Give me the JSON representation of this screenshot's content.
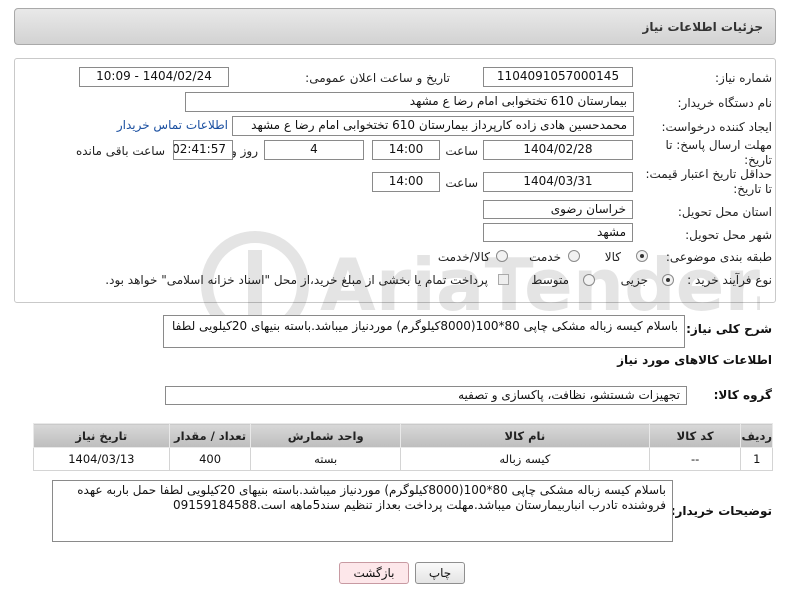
{
  "header": {
    "title": "جزئیات اطلاعات نیاز"
  },
  "form": {
    "need_number_label": "شماره نیاز:",
    "need_number": "1104091057000145",
    "announce_label": "تاریخ و ساعت اعلان عمومی:",
    "announce_value": "1404/02/24 - 10:09",
    "buyer_org_label": "نام دستگاه خریدار:",
    "buyer_org": "بیمارستان 610 تختخوابی امام رضا ع  مشهد",
    "requester_label": "ایجاد کننده درخواست:",
    "requester": "محمدحسین هادی زاده کارپرداز بیمارستان 610 تختخوابی امام رضا ع  مشهد",
    "buyer_contact_link": "اطلاعات تماس خریدار",
    "reply_deadline_label": "مهلت ارسال پاسخ: تا تاریخ:",
    "reply_date": "1404/02/28",
    "time_label": "ساعت",
    "reply_time": "14:00",
    "days_value": "4",
    "days_label": "روز و",
    "remaining_time": "02:41:57",
    "remaining_label": "ساعت باقی مانده",
    "price_validity_label": "حداقل تاریخ اعتبار قیمت: تا تاریخ:",
    "price_date": "1404/03/31",
    "price_time": "14:00",
    "province_label": "استان محل تحویل:",
    "province": "خراسان رضوی",
    "city_label": "شهر محل تحویل:",
    "city": "مشهد",
    "category_label": "طبقه بندی موضوعی:",
    "category_options": [
      "کالا",
      "خدمت",
      "کالا/خدمت"
    ],
    "purchase_type_label": "نوع فرآیند خرید :",
    "purchase_options": [
      "جزیی",
      "متوسط"
    ],
    "payment_note": "پرداخت تمام یا بخشی از مبلغ خرید،از محل \"اسناد خزانه اسلامی\" خواهد بود."
  },
  "summary": {
    "label": "شرح کلی نیاز:",
    "text": "باسلام کیسه زباله مشکی چاپی 80*100(8000کیلوگرم) موردنیاز میباشد.باسته بنیهای  20کیلویی لطفا"
  },
  "goods_info_title": "اطلاعات کالاهای مورد نیاز",
  "goods_group": {
    "label": "گروه کالا:",
    "value": "تجهیزات شستشو، نظافت، پاکسازی و تصفیه"
  },
  "table": {
    "headers": [
      "ردیف",
      "کد کالا",
      "نام کالا",
      "واحد شمارش",
      "تعداد / مقدار",
      "تاریخ نیاز"
    ],
    "rows": [
      [
        "1",
        "--",
        "کیسه زباله",
        "بسته",
        "400",
        "1404/03/13"
      ]
    ]
  },
  "buyer_notes": {
    "label": "توضیحات خریدار:",
    "text": "باسلام کیسه زباله مشکی چاپی 80*100(8000کیلوگرم) موردنیاز میباشد.باسته بنیهای  20کیلویی لطفا حمل باربه عهده فروشنده تادرب انباربیمارستان میباشد.مهلت پرداخت بعداز تنظیم سند5ماهه است.09159184588"
  },
  "buttons": {
    "print": "چاپ",
    "back": "بازگشت"
  }
}
